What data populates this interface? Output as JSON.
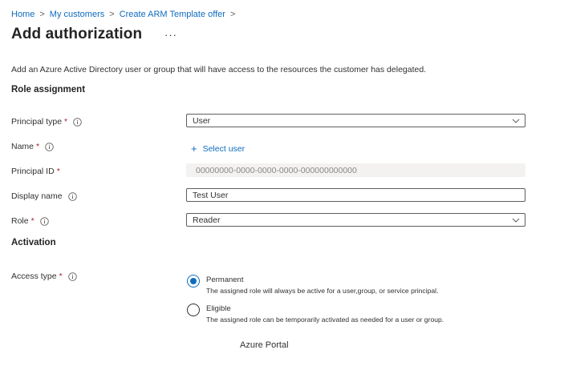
{
  "breadcrumb": {
    "items": [
      "Home",
      "My customers",
      "Create ARM Template offer"
    ],
    "separator": ">"
  },
  "page": {
    "title": "Add authorization",
    "more": "···",
    "description": "Add an Azure Active Directory user or group that will have access to the resources the customer has delegated."
  },
  "role_assignment": {
    "heading": "Role assignment",
    "principal_type": {
      "label": "Principal type",
      "required": "*",
      "value": "User",
      "info_icon": "info-icon"
    },
    "name": {
      "label": "Name",
      "required": "*",
      "action": "Select user",
      "action_icon": "plus-icon"
    },
    "principal_id": {
      "label": "Principal ID",
      "required": "*",
      "value": "00000000-0000-0000-0000-000000000000"
    },
    "display_name": {
      "label": "Display name",
      "value": "Test User"
    },
    "role": {
      "label": "Role",
      "required": "*",
      "value": "Reader"
    }
  },
  "activation": {
    "heading": "Activation",
    "access_type": {
      "label": "Access type",
      "required": "*",
      "options": [
        {
          "title": "Permanent",
          "description": "The assigned role will always be active for a user,group, or service principal.",
          "selected": true
        },
        {
          "title": "Eligible",
          "description": "The assigned role can be temporarily activated as needed for a user or group.",
          "selected": false
        }
      ]
    }
  },
  "caption": "Azure Portal",
  "colors": {
    "link": "#0f6cbd",
    "required": "#a4262c",
    "text": "#323130",
    "disabled_bg": "#f3f2f1"
  }
}
